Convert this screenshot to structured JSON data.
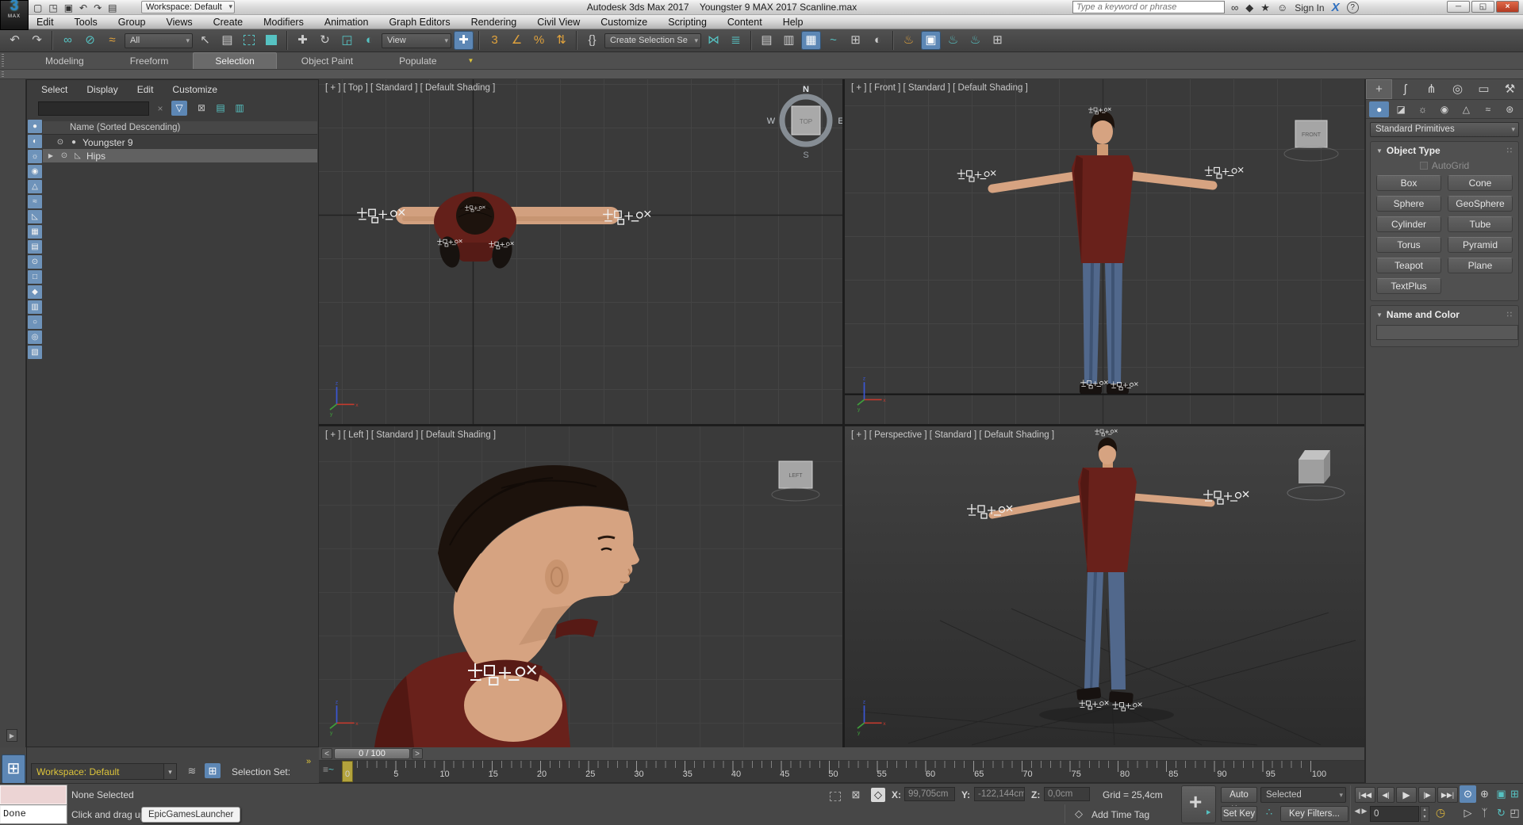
{
  "titlebar": {
    "logo": "3",
    "logo_sub": "MAX",
    "workspace": "Workspace: Default",
    "app_title": "Autodesk 3ds Max 2017",
    "doc_title": "Youngster 9 MAX 2017 Scanline.max",
    "search_placeholder": "Type a keyword or phrase",
    "sign_in": "Sign In"
  },
  "menubar": {
    "items": [
      "Edit",
      "Tools",
      "Group",
      "Views",
      "Create",
      "Modifiers",
      "Animation",
      "Graph Editors",
      "Rendering",
      "Civil View",
      "Customize",
      "Scripting",
      "Content",
      "Help"
    ]
  },
  "toolbar": {
    "filter_all": "All",
    "ref_coord": "View",
    "named_sel": "Create Selection Se"
  },
  "ribbon": {
    "tabs": [
      "Modeling",
      "Freeform",
      "Selection",
      "Object Paint",
      "Populate"
    ]
  },
  "explorer": {
    "menu": [
      "Select",
      "Display",
      "Edit",
      "Customize"
    ],
    "header": "Name (Sorted Descending)",
    "rows": [
      {
        "label": "Youngster 9"
      },
      {
        "label": "Hips"
      }
    ],
    "filters": [
      {
        "g": "●"
      },
      {
        "g": "◐"
      },
      {
        "g": "☼"
      },
      {
        "g": "◉"
      },
      {
        "g": "△"
      },
      {
        "g": "≈"
      },
      {
        "g": "◺"
      },
      {
        "g": "▦"
      },
      {
        "g": "▤"
      },
      {
        "g": "⊙"
      },
      {
        "g": "□"
      },
      {
        "g": "◆"
      },
      {
        "g": "▥"
      },
      {
        "g": "○"
      },
      {
        "g": "◎"
      },
      {
        "g": "▧"
      }
    ]
  },
  "viewports": {
    "top": "[ + ] [ Top ] [ Standard ] [ Default Shading ]",
    "front": "[ + ] [ Front ] [ Standard ] [ Default Shading ]",
    "left": "[ + ] [ Left ] [ Standard ] [ Default Shading ]",
    "persp": "[ + ] [ Perspective ] [ Standard ] [ Default Shading ]",
    "cube_top": "TOP",
    "cube_front": "FRONT",
    "cube_left": "LEFT",
    "compass": {
      "n": "N",
      "s": "S",
      "e": "E",
      "w": "W"
    },
    "axis": {
      "x": "x",
      "y": "y",
      "z": "z"
    }
  },
  "panel": {
    "category": "Standard Primitives",
    "object_type": "Object Type",
    "autogrid": "AutoGrid",
    "buttons": [
      "Box",
      "Cone",
      "Sphere",
      "GeoSphere",
      "Cylinder",
      "Tube",
      "Torus",
      "Pyramid",
      "Teapot",
      "Plane",
      "TextPlus"
    ],
    "name_color": "Name and Color"
  },
  "timeline": {
    "slider": "0 / 100",
    "ticks": [
      "0",
      "5",
      "10",
      "15",
      "20",
      "25",
      "30",
      "35",
      "40",
      "45",
      "50",
      "55",
      "60",
      "65",
      "70",
      "75",
      "80",
      "85",
      "90",
      "95",
      "100"
    ]
  },
  "status": {
    "done": "Done",
    "none_selected": "None Selected",
    "prompt": "Click and drag up-and-",
    "tooltip": "EpicGamesLauncher",
    "x": "X:",
    "xv": "99,705cm",
    "y": "Y:",
    "yv": "-122,144cm",
    "z": "Z:",
    "zv": "0,0cm",
    "grid": "Grid = 25,4cm",
    "add_time_tag": "Add Time Tag",
    "auto_key": "Auto Key",
    "set_key": "Set Key",
    "selected": "Selected",
    "key_filters": "Key Filters...",
    "frame": "0",
    "workspace": "Workspace: Default",
    "selection_set": "Selection Set:",
    "chev": "»"
  },
  "icons": {
    "new": "▢",
    "open": "◳",
    "save": "▣",
    "undo": "↶",
    "redo": "↷",
    "clip": "▤",
    "binoculars": "∞",
    "comm": "◆",
    "star": "★",
    "user": "☺",
    "exchange": "X",
    "help": "?",
    "min": "─",
    "restore": "◱",
    "close": "×",
    "link": "∞",
    "unlink": "⊘",
    "bind": "≈",
    "select": "↖",
    "selbyname": "▤",
    "move": "✚",
    "rotate": "↻",
    "scale": "◲",
    "snap3": "3",
    "snapang": "∠",
    "snappct": "%",
    "snapspin": "⇅",
    "sets": "{}",
    "mirror": "⋈",
    "align": "≣",
    "tog_explorer": "▤",
    "tog_layer": "▥",
    "tog_ribbon": "▦",
    "curve": "~",
    "schematic": "⊞",
    "material": "◐",
    "rsetup": "♨",
    "rframe": "▣",
    "render": "♨",
    "renderit": "♨",
    "ribbon_dd": "▼",
    "clear": "×",
    "funnel": "▽",
    "lock": "⊠",
    "tree1": "▤",
    "tree2": "▥",
    "eye": "⊙",
    "geo_dot": "●",
    "bone": "◺",
    "expand": "▶",
    "grip": "∷",
    "roll_arrow": "▼",
    "layers": "≋",
    "sceneexp": "⊞",
    "lockb": "⊠",
    "xyz": "◇",
    "cube": "◇",
    "keyplus": "+",
    "key": "‣",
    "setkeymode": "∴",
    "t_start": "|◀◀",
    "t_prev": "◀|",
    "t_play": "▶",
    "t_next": "|▶",
    "t_end": "▶▶|",
    "sl_prev": "<",
    "sl_next": ">",
    "fr_l": "◀",
    "fr_r": "▶",
    "spin_up": "▴",
    "spin_dn": "▾",
    "clock": "◷",
    "n_zoom": "⊙",
    "n_zoomall": "⊕",
    "n_zext": "▣",
    "n_zextall": "⊞",
    "n_fov": "▷",
    "n_walk": "ᛉ",
    "n_orbit": "↻",
    "n_max": "◰",
    "cp_create": "+",
    "cp_modify": "ʃ",
    "cp_hier": "⋔",
    "cp_motion": "◎",
    "cp_disp": "▭",
    "cp_util": "⚒",
    "cp_geo": "●",
    "cp_shapes": "◪",
    "cp_lights": "☼",
    "cp_cams": "◉",
    "cp_help": "△",
    "cp_space": "≈",
    "cp_sys": "⊛",
    "mc1": "≡",
    "mc2": "~"
  }
}
